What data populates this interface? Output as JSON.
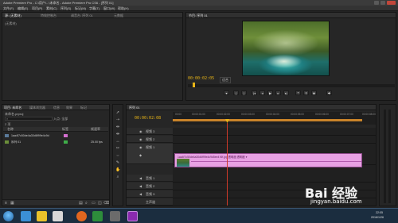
{
  "app": {
    "title": "Adobe Premiere Pro - C:\\用户\\...\\未命名 - Adobe Premiere Pro CS6 - [序列 01]"
  },
  "menubar": {
    "items": [
      "文件(F)",
      "编辑(E)",
      "项目(P)",
      "素材(C)",
      "序列(S)",
      "标记(M)",
      "字幕(T)",
      "窗口(W)",
      "帮助(H)"
    ]
  },
  "source_panel": {
    "tabs": [
      "源: (无素材)",
      "特效控制台",
      "调音台: 序列 01",
      "元数据"
    ],
    "no_clip_label": "(无素材)"
  },
  "program_monitor": {
    "tab": "节目: 序列 01",
    "timecode": "00:00:02:05",
    "fit_label": "适合"
  },
  "project_panel": {
    "tabs": [
      "项目: 未命名",
      "媒体浏览器",
      "信息",
      "效果",
      "标记"
    ],
    "project_name": "未命名.prproj",
    "item_count": "2 项",
    "entry_label": "入点: 全部",
    "columns": [
      "名称",
      "标签",
      "帧速率"
    ],
    "items": [
      {
        "name": "1aa4f7c50de4a30d6f99e4c9d",
        "rate": ""
      },
      {
        "name": "序列 01",
        "rate": "25.00 fps"
      }
    ]
  },
  "timeline": {
    "tab": "序列 01",
    "timecode": "00:00:02:08",
    "ruler_labels": [
      "00:00",
      "00:00:01:00",
      "00:00:02:00",
      "00:00:03:00",
      "00:00:04:00",
      "00:00:05:00",
      "00:00:06:00",
      "00:00:07:00",
      "00:00:08:00"
    ],
    "tracks": [
      {
        "name": "视频 3"
      },
      {
        "name": "视频 2"
      },
      {
        "name": "视频 1"
      },
      {
        "name": "音频 1"
      },
      {
        "name": "音频 2"
      },
      {
        "name": "音频 3"
      },
      {
        "name": "主声道"
      }
    ],
    "clip_label": "1aa4f7c50de4a30d6f99e4c9d5ee4 f6f.jpg 透明度:透明度 ▾"
  },
  "taskbar": {
    "time": "22:05",
    "date": "2016/1/26",
    "icon_colors": [
      "#3b8fd6",
      "#e8c12a",
      "#d8d8d8",
      "#e0661f",
      "#2d8d3b",
      "#6b6b6b",
      "#8a2bb0"
    ]
  },
  "watermark": {
    "brand": "Bai 经验",
    "url": "jingyan.baidu.com"
  }
}
